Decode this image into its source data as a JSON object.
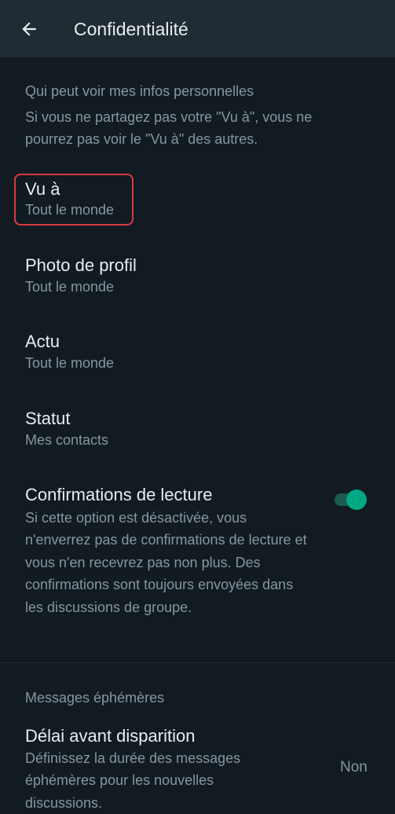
{
  "header": {
    "title": "Confidentialité",
    "back_icon": "arrow-left-icon"
  },
  "personal_info": {
    "header": "Qui peut voir mes infos personnelles",
    "description": "Si vous ne partagez pas votre \"Vu à\", vous ne pourrez pas voir le \"Vu à\" des autres."
  },
  "items": [
    {
      "title": "Vu à",
      "value": "Tout le monde"
    },
    {
      "title": "Photo de profil",
      "value": "Tout le monde"
    },
    {
      "title": "Actu",
      "value": "Tout le monde"
    },
    {
      "title": "Statut",
      "value": "Mes contacts"
    }
  ],
  "read_receipts": {
    "title": "Confirmations de lecture",
    "description": "Si cette option est désactivée, vous n'enverrez pas de confirmations de lecture et vous n'en recevrez pas non plus. Des confirmations sont toujours envoyées dans les discussions de groupe.",
    "enabled": true
  },
  "ephemeral": {
    "header": "Messages éphémères",
    "title": "Délai avant disparition",
    "description": "Définissez la durée des messages éphémères pour les nouvelles discussions.",
    "value": "Non"
  },
  "colors": {
    "background": "#111b21",
    "header_bg": "#1f2c34",
    "accent": "#00a884",
    "highlight_border": "#d83a3f",
    "secondary_text": "#8696a0",
    "primary_text": "#e9edef"
  }
}
